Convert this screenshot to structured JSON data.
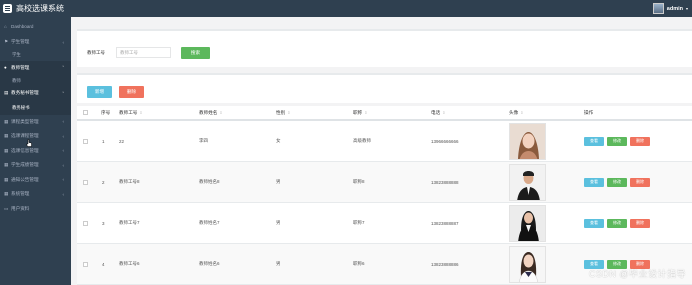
{
  "app": {
    "title": "高校选课系统",
    "user": "admin"
  },
  "sidebar": {
    "items": [
      {
        "label": "Dashboard",
        "icon": "home-icon",
        "open": false
      },
      {
        "label": "学生管理",
        "icon": "flag-icon",
        "open": false,
        "children": [
          {
            "label": "学生",
            "active": false
          }
        ]
      },
      {
        "label": "教师管理",
        "icon": "user-icon",
        "open": true,
        "children": [
          {
            "label": "教师",
            "active": false
          }
        ]
      },
      {
        "label": "教务秘书管理",
        "icon": "bank-icon",
        "open": true,
        "children": [
          {
            "label": "教务秘书",
            "active": true
          }
        ]
      },
      {
        "label": "课程类型管理",
        "icon": "grid-icon",
        "open": false
      },
      {
        "label": "选课课程管理",
        "icon": "grid-icon",
        "open": false
      },
      {
        "label": "选课信息管理",
        "icon": "grid-icon",
        "open": false
      },
      {
        "label": "学生成绩管理",
        "icon": "grid-icon",
        "open": false
      },
      {
        "label": "通知公告管理",
        "icon": "grid-icon",
        "open": false
      },
      {
        "label": "系统管理",
        "icon": "grid-icon",
        "open": false
      },
      {
        "label": "用户资料",
        "icon": "card-icon",
        "open": false
      }
    ]
  },
  "search": {
    "label": "教师工号",
    "placeholder": "教师工号",
    "button": "搜索"
  },
  "actions": {
    "add": "新增",
    "delete": "删除"
  },
  "table": {
    "columns": [
      "序号",
      "教师工号",
      "教师姓名",
      "性别",
      "职称",
      "电话",
      "头像",
      "操作"
    ],
    "rows": [
      {
        "index": "1",
        "id": "22",
        "name": "李四",
        "gender": "女",
        "title": "高级教师",
        "phone": "13966666666"
      },
      {
        "index": "2",
        "id": "教师工号8",
        "name": "教师姓名8",
        "gender": "男",
        "title": "职称8",
        "phone": "13823888888"
      },
      {
        "index": "3",
        "id": "教师工号7",
        "name": "教师姓名7",
        "gender": "男",
        "title": "职称7",
        "phone": "13823888887"
      },
      {
        "index": "4",
        "id": "教师工号6",
        "name": "教师姓名6",
        "gender": "男",
        "title": "职称6",
        "phone": "13823888886"
      }
    ],
    "ops": {
      "view": "查看",
      "edit": "修改",
      "remove": "删除"
    }
  },
  "watermark": "CSDN @毕业设计指导",
  "colors": {
    "sidebar": "#2f4050",
    "info": "#5bc0de",
    "success": "#5cb85c",
    "danger": "#f0725d"
  }
}
